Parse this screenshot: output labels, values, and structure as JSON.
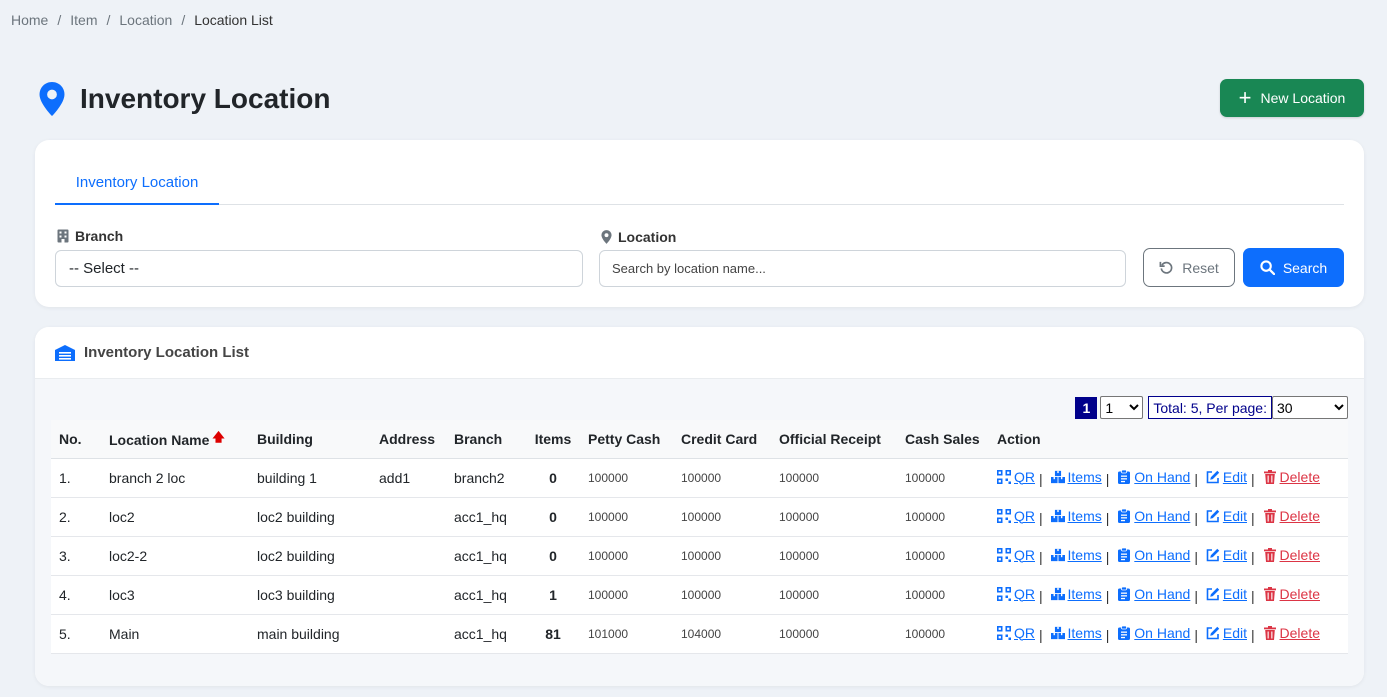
{
  "breadcrumb": [
    "Home",
    "Item",
    "Location",
    "Location List"
  ],
  "page": {
    "title": "Inventory Location",
    "new_button": "New Location"
  },
  "filter": {
    "tab": "Inventory Location",
    "branch_label": "Branch",
    "branch_selected": "-- Select --",
    "location_label": "Location",
    "location_placeholder": "Search by location name...",
    "reset_label": "Reset",
    "search_label": "Search"
  },
  "list": {
    "title": "Inventory Location List",
    "pager": {
      "current_page": "1",
      "page_select": "1",
      "total_text": "Total: 5, Per page:",
      "per_page": "30"
    },
    "columns": [
      "No.",
      "Location Name",
      "Building",
      "Address",
      "Branch",
      "Items",
      "Petty Cash",
      "Credit Card",
      "Official Receipt",
      "Cash Sales",
      "Action"
    ],
    "actions": {
      "qr": "QR",
      "items": "Items",
      "on_hand": "On Hand",
      "edit": "Edit",
      "delete": "Delete"
    },
    "rows": [
      {
        "no": "1.",
        "name": "branch 2 loc",
        "building": "building 1",
        "address": "add1",
        "branch": "branch2",
        "items": "0",
        "petty": "100000",
        "credit": "100000",
        "receipt": "100000",
        "cash": "100000"
      },
      {
        "no": "2.",
        "name": "loc2",
        "building": "loc2 building",
        "address": "",
        "branch": "acc1_hq",
        "items": "0",
        "petty": "100000",
        "credit": "100000",
        "receipt": "100000",
        "cash": "100000"
      },
      {
        "no": "3.",
        "name": "loc2-2",
        "building": "loc2 building",
        "address": "",
        "branch": "acc1_hq",
        "items": "0",
        "petty": "100000",
        "credit": "100000",
        "receipt": "100000",
        "cash": "100000"
      },
      {
        "no": "4.",
        "name": "loc3",
        "building": "loc3 building",
        "address": "",
        "branch": "acc1_hq",
        "items": "1",
        "petty": "100000",
        "credit": "100000",
        "receipt": "100000",
        "cash": "100000"
      },
      {
        "no": "5.",
        "name": "Main",
        "building": "main building",
        "address": "",
        "branch": "acc1_hq",
        "items": "81",
        "petty": "101000",
        "credit": "104000",
        "receipt": "100000",
        "cash": "100000"
      }
    ]
  },
  "colors": {
    "primary": "#0d6efd",
    "success": "#198754",
    "danger": "#dc3545",
    "pager": "#00008b"
  }
}
